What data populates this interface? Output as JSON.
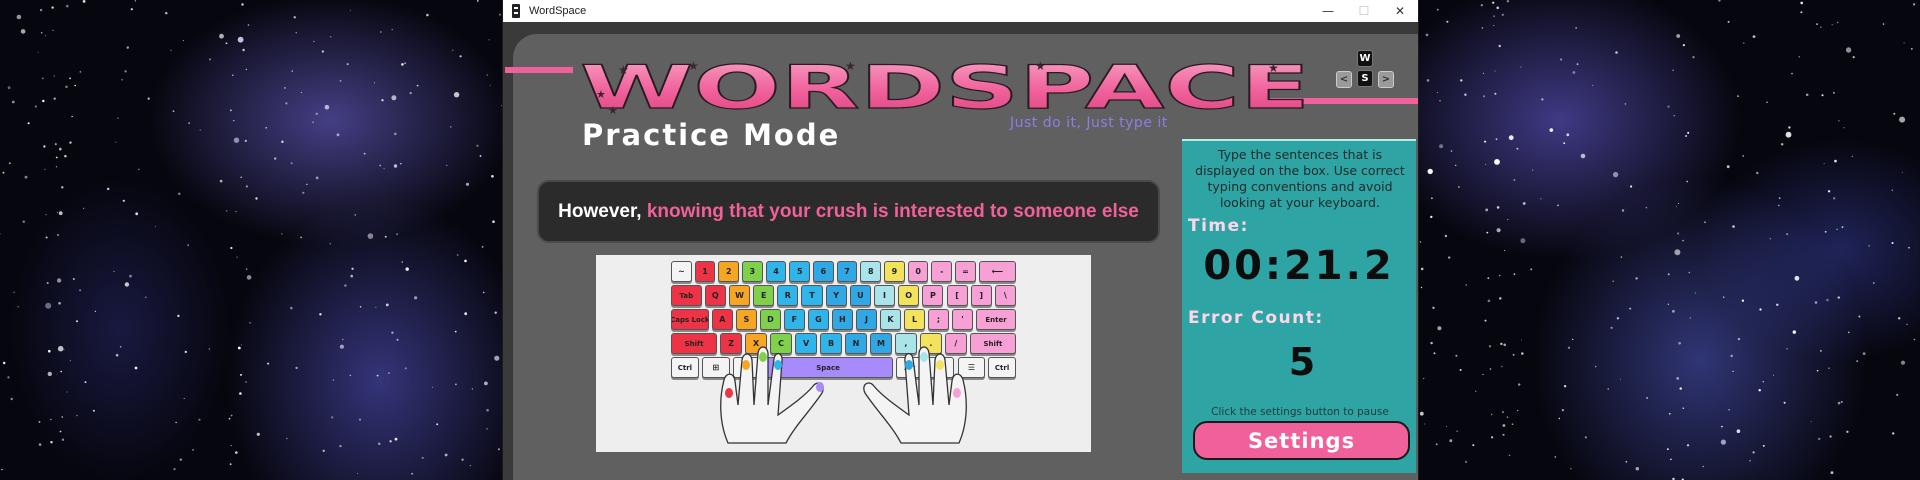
{
  "window": {
    "title": "WordSpace",
    "controls": {
      "minimize": "—",
      "maximize": "☐",
      "close": "✕"
    }
  },
  "header": {
    "logo_text": "WORDSPACE",
    "tagline": "Just do it, Just type it",
    "mode_title": "Practice Mode",
    "mini_keys": [
      "W",
      "S",
      "<",
      ">"
    ]
  },
  "sentence": {
    "typed": "However,",
    "remaining": "knowing that your crush is interested to someone else"
  },
  "keyboard": {
    "rows": [
      [
        {
          "l": "~",
          "c": "#f4f4f4"
        },
        {
          "l": "1",
          "c": "#ee3346"
        },
        {
          "l": "2",
          "c": "#f6a623"
        },
        {
          "l": "3",
          "c": "#7fd14b"
        },
        {
          "l": "4",
          "c": "#2fb5ea"
        },
        {
          "l": "5",
          "c": "#2fb5ea"
        },
        {
          "l": "6",
          "c": "#31a8e6"
        },
        {
          "l": "7",
          "c": "#31a8e6"
        },
        {
          "l": "8",
          "c": "#a9e4ea"
        },
        {
          "l": "9",
          "c": "#f2e25c"
        },
        {
          "l": "0",
          "c": "#f7a0d6"
        },
        {
          "l": "-",
          "c": "#f7a0d6"
        },
        {
          "l": "=",
          "c": "#f7a0d6"
        },
        {
          "l": "⟵",
          "c": "#f7a0d6"
        }
      ],
      [
        {
          "l": "Tab",
          "c": "#ee3346"
        },
        {
          "l": "Q",
          "c": "#ee3346"
        },
        {
          "l": "W",
          "c": "#f6a623"
        },
        {
          "l": "E",
          "c": "#7fd14b"
        },
        {
          "l": "R",
          "c": "#2fb5ea"
        },
        {
          "l": "T",
          "c": "#2fb5ea"
        },
        {
          "l": "Y",
          "c": "#31a8e6"
        },
        {
          "l": "U",
          "c": "#31a8e6"
        },
        {
          "l": "I",
          "c": "#a9e4ea"
        },
        {
          "l": "O",
          "c": "#f2e25c"
        },
        {
          "l": "P",
          "c": "#f7a0d6"
        },
        {
          "l": "[",
          "c": "#f7a0d6"
        },
        {
          "l": "]",
          "c": "#f7a0d6"
        },
        {
          "l": "\\",
          "c": "#f7a0d6"
        }
      ],
      [
        {
          "l": "Caps Lock",
          "c": "#ee3346"
        },
        {
          "l": "A",
          "c": "#ee3346"
        },
        {
          "l": "S",
          "c": "#f6a623"
        },
        {
          "l": "D",
          "c": "#7fd14b"
        },
        {
          "l": "F",
          "c": "#2fb5ea"
        },
        {
          "l": "G",
          "c": "#2fb5ea"
        },
        {
          "l": "H",
          "c": "#31a8e6"
        },
        {
          "l": "J",
          "c": "#31a8e6"
        },
        {
          "l": "K",
          "c": "#a9e4ea"
        },
        {
          "l": "L",
          "c": "#f2e25c"
        },
        {
          "l": ";",
          "c": "#f7a0d6"
        },
        {
          "l": "'",
          "c": "#f7a0d6"
        },
        {
          "l": "Enter",
          "c": "#f7a0d6"
        }
      ],
      [
        {
          "l": "Shift",
          "c": "#ee3346"
        },
        {
          "l": "Z",
          "c": "#ee3346"
        },
        {
          "l": "X",
          "c": "#f6a623"
        },
        {
          "l": "C",
          "c": "#7fd14b"
        },
        {
          "l": "V",
          "c": "#2fb5ea"
        },
        {
          "l": "B",
          "c": "#2fb5ea"
        },
        {
          "l": "N",
          "c": "#31a8e6"
        },
        {
          "l": "M",
          "c": "#31a8e6"
        },
        {
          "l": ",",
          "c": "#a9e4ea"
        },
        {
          "l": ".",
          "c": "#f2e25c"
        },
        {
          "l": "/",
          "c": "#f7a0d6"
        },
        {
          "l": "Shift",
          "c": "#f7a0d6"
        }
      ],
      [
        {
          "l": "Ctrl",
          "c": "#f4f4f4"
        },
        {
          "l": "⊞",
          "c": "#f4f4f4"
        },
        {
          "l": "Alt",
          "c": "#f4f4f4"
        },
        {
          "l": "Space",
          "c": "#a78bfa"
        },
        {
          "l": "Alt",
          "c": "#f4f4f4"
        },
        {
          "l": "⊞",
          "c": "#f4f4f4"
        },
        {
          "l": "☰",
          "c": "#f4f4f4"
        },
        {
          "l": "Ctrl",
          "c": "#f4f4f4"
        }
      ]
    ]
  },
  "panel": {
    "instructions": "Type the sentences that is displayed on the box. Use correct typing conventions and avoid looking at your keyboard.",
    "time_label": "Time:",
    "time_value": "00:21.2",
    "error_label": "Error Count:",
    "error_value": "5",
    "hint": "Click the settings button to pause",
    "settings_label": "Settings"
  },
  "colors": {
    "accent_pink": "#f0609a",
    "panel_teal": "#2fa4a4",
    "app_gray": "#606060",
    "tagline_purple": "#8a7fe6"
  }
}
